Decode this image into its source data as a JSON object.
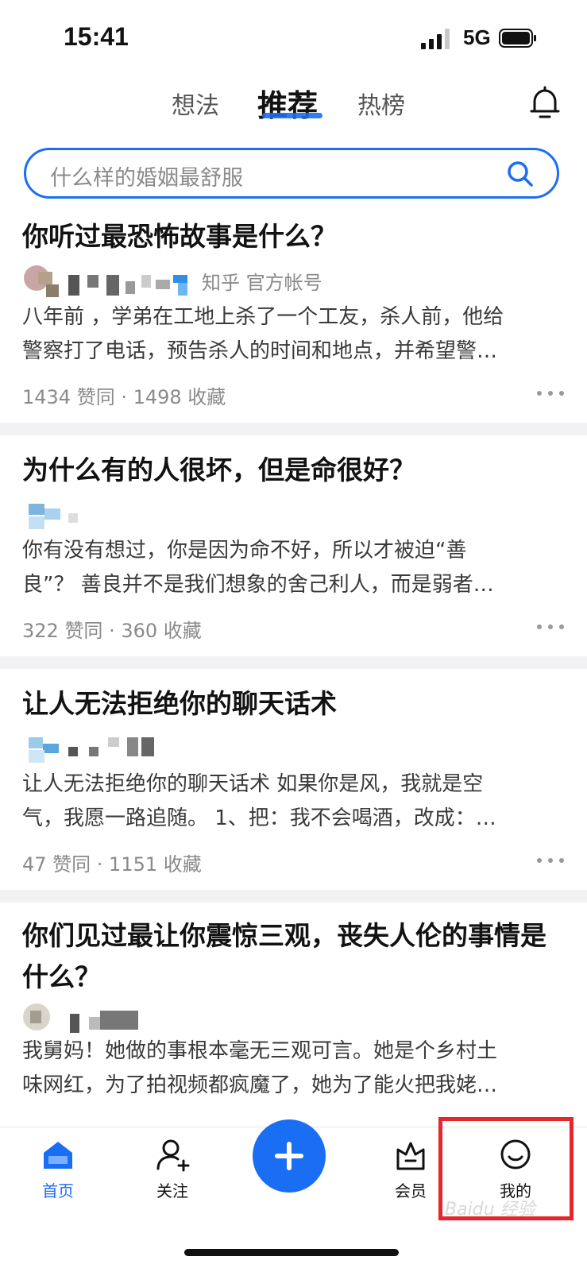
{
  "status": {
    "time": "15:41",
    "network": "5G"
  },
  "top_tabs": [
    {
      "label": "想法"
    },
    {
      "label": "推荐",
      "active": true
    },
    {
      "label": "热榜"
    }
  ],
  "search": {
    "placeholder": "什么样的婚姻最舒服"
  },
  "feed": [
    {
      "title": "你听过最恐怖故事是什么？",
      "author_tag": "知乎 官方帐号",
      "excerpt_lines": [
        "八年前 ，学弟在工地上杀了一个工友，杀人前，他给",
        "警察打了电话，预告杀人的时间和地点，并希望警…"
      ],
      "meta": "1434 赞同 · 1498 收藏"
    },
    {
      "title": "为什么有的人很坏，但是命很好？",
      "excerpt_lines": [
        "你有没有想过，你是因为命不好，所以才被迫“善",
        "良”？ 善良并不是我们想象的舍己利人，而是弱者…"
      ],
      "meta": "322 赞同 · 360 收藏"
    },
    {
      "title": "让人无法拒绝你的聊天话术",
      "excerpt_lines": [
        "让人无法拒绝你的聊天话术 如果你是风，我就是空",
        "气，我愿一路追随。 1、把：我不会喝酒，改成：…"
      ],
      "meta": "47 赞同 · 1151 收藏"
    },
    {
      "title": "你们见过最让你震惊三观，丧失人伦的事情是什么？",
      "excerpt_lines": [
        "我舅妈！她做的事根本毫无三观可言。她是个乡村土",
        "味网红，为了拍视频都疯魔了，她为了能火把我姥…"
      ]
    }
  ],
  "bottom_nav": [
    {
      "label": "首页",
      "icon": "home-icon",
      "active": true
    },
    {
      "label": "关注",
      "icon": "follow-icon"
    },
    {
      "label": "会员",
      "icon": "vip-icon"
    },
    {
      "label": "我的",
      "icon": "profile-icon"
    }
  ],
  "watermark": "Baidu 经验",
  "colors": {
    "accent": "#1a6ef4",
    "highlight": "#e5262a"
  }
}
